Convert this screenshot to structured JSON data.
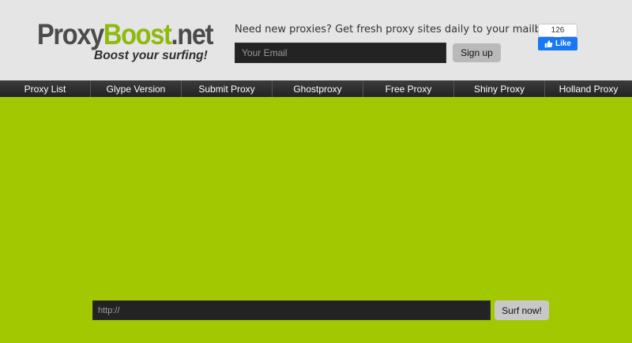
{
  "header": {
    "logo": {
      "part1": "Proxy",
      "part2": "Boost",
      "part3": ".net",
      "tagline": "Boost your surfing!"
    },
    "promo_text": "Need new proxies? Get fresh proxy sites daily to your mailbox!",
    "email_placeholder": "Your Email",
    "signup_label": "Sign up",
    "facebook": {
      "count": "126",
      "like_label": "Like"
    }
  },
  "nav": {
    "items": [
      "Proxy List",
      "Glype Version",
      "Submit Proxy",
      "Ghostproxy",
      "Free Proxy",
      "Shiny Proxy",
      "Holland Proxy"
    ]
  },
  "surf": {
    "url_placeholder": "http://",
    "button_label": "Surf now!"
  },
  "colors": {
    "background": "#a1c800",
    "header_bg": "#e5e5e5",
    "nav_bg": "#2e2e2e",
    "facebook_blue": "#1877f2",
    "logo_green": "#8dba0b"
  }
}
